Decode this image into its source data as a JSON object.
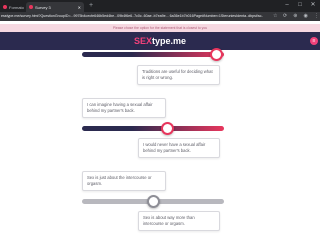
{
  "browser": {
    "tabs": [
      {
        "label": "Formato",
        "active": false
      },
      {
        "label": "Survey 3",
        "active": true
      }
    ],
    "new_tab": "+",
    "window_controls": {
      "minimize": "–",
      "maximize": "□",
      "close": "✕"
    },
    "url": "esstype.me/survey.html?QuestionGroupID=...9975b4cecfe646b5ed4be...09b4f6e6..7c0c..60ae..b7ea9e... 6a36e1b7b016Page#Number=1SteruniesIdenta..dbpst/sc-",
    "bookmark_icon": "☆",
    "toolbar_icons": [
      "⟳",
      "⊕",
      "◉",
      "⋮"
    ]
  },
  "notice": {
    "text": "Please chose the option for the statement that is closest to you"
  },
  "header": {
    "logo_part1": "SEX",
    "logo_part2": "type.me",
    "menu_icon": "≡"
  },
  "questions": [
    {
      "statement_right": "Traditions are useful for deciding what is right or wrong.",
      "slider_value": 0.95,
      "slider_active": true
    },
    {
      "statement_left": "I can imagine having a sexual affair behind my partner's back.",
      "statement_right": "I would never have a sexual affair behind my partner's back.",
      "slider_value": 0.6,
      "slider_active": true
    },
    {
      "statement_left": "Sex is just about the intercourse or orgasm.",
      "statement_right": "Sex is about way more than intercourse or orgasm.",
      "slider_value": 0.5,
      "slider_active": false
    }
  ],
  "colors": {
    "accent": "#e8365d",
    "header_bg": "#2b2a4f",
    "track_dark": "#2b2a4f",
    "track_grey": "#b8b8be",
    "notice_bg": "#f6d8e1"
  }
}
